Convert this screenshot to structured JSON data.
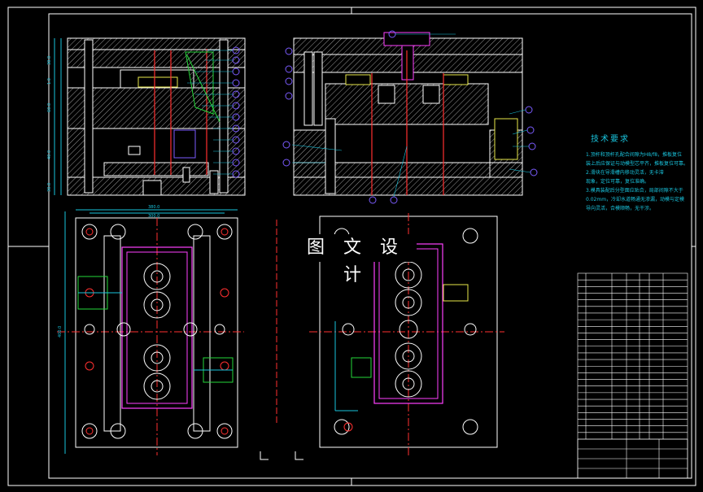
{
  "drawing": {
    "watermark": "图 文 设 计",
    "notes_title": "技术要求",
    "notes_lines": [
      "1.顶杆和顶杆孔配合间隙为H8/f8，推板复位",
      "装上后应保证与动模型芯平齐，推板复位可靠。",
      "2.滑块在导滑槽内移动灵活，无卡滞",
      "现象，定位可靠，复位准确。",
      "3.模具装配后分型面应贴合，局部间隙不大于",
      "0.02mm，冷却水道畅通无渗漏，动模与定模",
      "导向灵活，合模顺畅，无干涉。"
    ],
    "dimensions_top": [
      "30.0",
      "1.0",
      "60.0",
      "40.0",
      "30.0",
      "25.0"
    ],
    "dimension_plan_top": [
      "380.0",
      "300.0"
    ],
    "dimension_plan_left": "400.0",
    "colors": {
      "background": "#000000",
      "outline": "#ffffff",
      "dimension": "#19c3dc",
      "balloon": "#7b5cff",
      "center_line": "#ff3030",
      "hatch": "#c8c8c8",
      "highlight": "#ff40ff",
      "green": "#25d83a",
      "yellow": "#e8e84a"
    }
  }
}
